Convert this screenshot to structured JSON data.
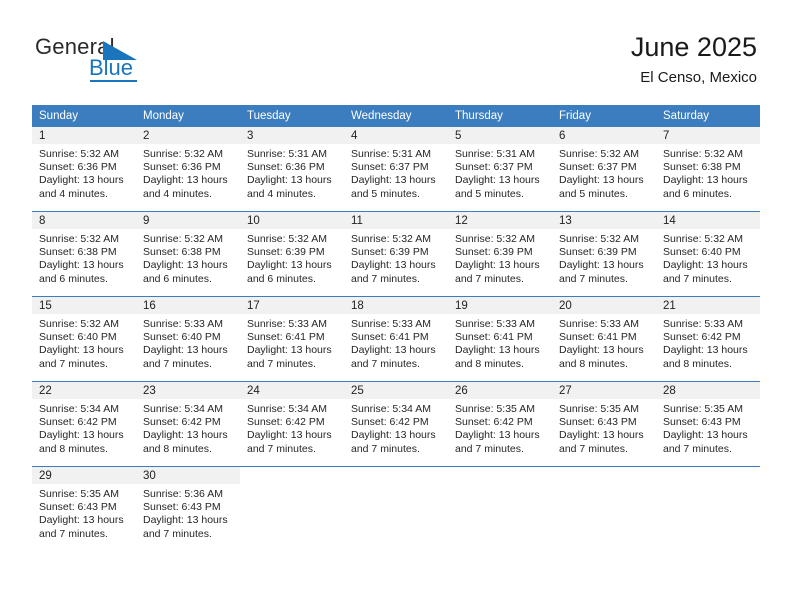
{
  "brand": {
    "name_part1": "General",
    "name_part2": "Blue",
    "triangle_icon": "triangle-flag-icon",
    "accent_color": "#1a75bc"
  },
  "header": {
    "title": "June 2025",
    "subtitle": "El Censo, Mexico",
    "header_bg": "#3b7dbf",
    "header_text_color": "#ffffff"
  },
  "weekday_headers": [
    "Sunday",
    "Monday",
    "Tuesday",
    "Wednesday",
    "Thursday",
    "Friday",
    "Saturday"
  ],
  "labels": {
    "sunrise": "Sunrise:",
    "sunset": "Sunset:",
    "daylight": "Daylight:"
  },
  "weeks": [
    [
      {
        "day": "1",
        "sunrise": "Sunrise: 5:32 AM",
        "sunset": "Sunset: 6:36 PM",
        "daylight1": "Daylight: 13 hours",
        "daylight2": "and 4 minutes."
      },
      {
        "day": "2",
        "sunrise": "Sunrise: 5:32 AM",
        "sunset": "Sunset: 6:36 PM",
        "daylight1": "Daylight: 13 hours",
        "daylight2": "and 4 minutes."
      },
      {
        "day": "3",
        "sunrise": "Sunrise: 5:31 AM",
        "sunset": "Sunset: 6:36 PM",
        "daylight1": "Daylight: 13 hours",
        "daylight2": "and 4 minutes."
      },
      {
        "day": "4",
        "sunrise": "Sunrise: 5:31 AM",
        "sunset": "Sunset: 6:37 PM",
        "daylight1": "Daylight: 13 hours",
        "daylight2": "and 5 minutes."
      },
      {
        "day": "5",
        "sunrise": "Sunrise: 5:31 AM",
        "sunset": "Sunset: 6:37 PM",
        "daylight1": "Daylight: 13 hours",
        "daylight2": "and 5 minutes."
      },
      {
        "day": "6",
        "sunrise": "Sunrise: 5:32 AM",
        "sunset": "Sunset: 6:37 PM",
        "daylight1": "Daylight: 13 hours",
        "daylight2": "and 5 minutes."
      },
      {
        "day": "7",
        "sunrise": "Sunrise: 5:32 AM",
        "sunset": "Sunset: 6:38 PM",
        "daylight1": "Daylight: 13 hours",
        "daylight2": "and 6 minutes."
      }
    ],
    [
      {
        "day": "8",
        "sunrise": "Sunrise: 5:32 AM",
        "sunset": "Sunset: 6:38 PM",
        "daylight1": "Daylight: 13 hours",
        "daylight2": "and 6 minutes."
      },
      {
        "day": "9",
        "sunrise": "Sunrise: 5:32 AM",
        "sunset": "Sunset: 6:38 PM",
        "daylight1": "Daylight: 13 hours",
        "daylight2": "and 6 minutes."
      },
      {
        "day": "10",
        "sunrise": "Sunrise: 5:32 AM",
        "sunset": "Sunset: 6:39 PM",
        "daylight1": "Daylight: 13 hours",
        "daylight2": "and 6 minutes."
      },
      {
        "day": "11",
        "sunrise": "Sunrise: 5:32 AM",
        "sunset": "Sunset: 6:39 PM",
        "daylight1": "Daylight: 13 hours",
        "daylight2": "and 7 minutes."
      },
      {
        "day": "12",
        "sunrise": "Sunrise: 5:32 AM",
        "sunset": "Sunset: 6:39 PM",
        "daylight1": "Daylight: 13 hours",
        "daylight2": "and 7 minutes."
      },
      {
        "day": "13",
        "sunrise": "Sunrise: 5:32 AM",
        "sunset": "Sunset: 6:39 PM",
        "daylight1": "Daylight: 13 hours",
        "daylight2": "and 7 minutes."
      },
      {
        "day": "14",
        "sunrise": "Sunrise: 5:32 AM",
        "sunset": "Sunset: 6:40 PM",
        "daylight1": "Daylight: 13 hours",
        "daylight2": "and 7 minutes."
      }
    ],
    [
      {
        "day": "15",
        "sunrise": "Sunrise: 5:32 AM",
        "sunset": "Sunset: 6:40 PM",
        "daylight1": "Daylight: 13 hours",
        "daylight2": "and 7 minutes."
      },
      {
        "day": "16",
        "sunrise": "Sunrise: 5:33 AM",
        "sunset": "Sunset: 6:40 PM",
        "daylight1": "Daylight: 13 hours",
        "daylight2": "and 7 minutes."
      },
      {
        "day": "17",
        "sunrise": "Sunrise: 5:33 AM",
        "sunset": "Sunset: 6:41 PM",
        "daylight1": "Daylight: 13 hours",
        "daylight2": "and 7 minutes."
      },
      {
        "day": "18",
        "sunrise": "Sunrise: 5:33 AM",
        "sunset": "Sunset: 6:41 PM",
        "daylight1": "Daylight: 13 hours",
        "daylight2": "and 7 minutes."
      },
      {
        "day": "19",
        "sunrise": "Sunrise: 5:33 AM",
        "sunset": "Sunset: 6:41 PM",
        "daylight1": "Daylight: 13 hours",
        "daylight2": "and 8 minutes."
      },
      {
        "day": "20",
        "sunrise": "Sunrise: 5:33 AM",
        "sunset": "Sunset: 6:41 PM",
        "daylight1": "Daylight: 13 hours",
        "daylight2": "and 8 minutes."
      },
      {
        "day": "21",
        "sunrise": "Sunrise: 5:33 AM",
        "sunset": "Sunset: 6:42 PM",
        "daylight1": "Daylight: 13 hours",
        "daylight2": "and 8 minutes."
      }
    ],
    [
      {
        "day": "22",
        "sunrise": "Sunrise: 5:34 AM",
        "sunset": "Sunset: 6:42 PM",
        "daylight1": "Daylight: 13 hours",
        "daylight2": "and 8 minutes."
      },
      {
        "day": "23",
        "sunrise": "Sunrise: 5:34 AM",
        "sunset": "Sunset: 6:42 PM",
        "daylight1": "Daylight: 13 hours",
        "daylight2": "and 8 minutes."
      },
      {
        "day": "24",
        "sunrise": "Sunrise: 5:34 AM",
        "sunset": "Sunset: 6:42 PM",
        "daylight1": "Daylight: 13 hours",
        "daylight2": "and 7 minutes."
      },
      {
        "day": "25",
        "sunrise": "Sunrise: 5:34 AM",
        "sunset": "Sunset: 6:42 PM",
        "daylight1": "Daylight: 13 hours",
        "daylight2": "and 7 minutes."
      },
      {
        "day": "26",
        "sunrise": "Sunrise: 5:35 AM",
        "sunset": "Sunset: 6:42 PM",
        "daylight1": "Daylight: 13 hours",
        "daylight2": "and 7 minutes."
      },
      {
        "day": "27",
        "sunrise": "Sunrise: 5:35 AM",
        "sunset": "Sunset: 6:43 PM",
        "daylight1": "Daylight: 13 hours",
        "daylight2": "and 7 minutes."
      },
      {
        "day": "28",
        "sunrise": "Sunrise: 5:35 AM",
        "sunset": "Sunset: 6:43 PM",
        "daylight1": "Daylight: 13 hours",
        "daylight2": "and 7 minutes."
      }
    ],
    [
      {
        "day": "29",
        "sunrise": "Sunrise: 5:35 AM",
        "sunset": "Sunset: 6:43 PM",
        "daylight1": "Daylight: 13 hours",
        "daylight2": "and 7 minutes."
      },
      {
        "day": "30",
        "sunrise": "Sunrise: 5:36 AM",
        "sunset": "Sunset: 6:43 PM",
        "daylight1": "Daylight: 13 hours",
        "daylight2": "and 7 minutes."
      },
      {
        "day": "",
        "sunrise": "",
        "sunset": "",
        "daylight1": "",
        "daylight2": ""
      },
      {
        "day": "",
        "sunrise": "",
        "sunset": "",
        "daylight1": "",
        "daylight2": ""
      },
      {
        "day": "",
        "sunrise": "",
        "sunset": "",
        "daylight1": "",
        "daylight2": ""
      },
      {
        "day": "",
        "sunrise": "",
        "sunset": "",
        "daylight1": "",
        "daylight2": ""
      },
      {
        "day": "",
        "sunrise": "",
        "sunset": "",
        "daylight1": "",
        "daylight2": ""
      }
    ]
  ]
}
